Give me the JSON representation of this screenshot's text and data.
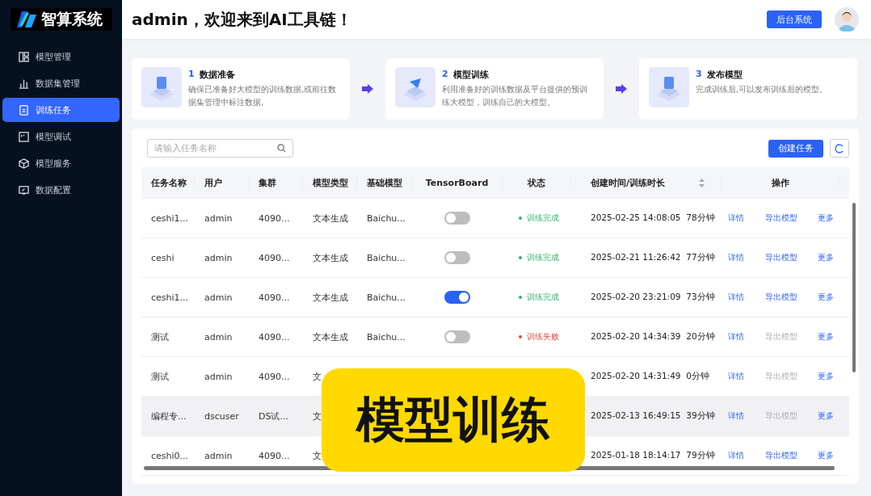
{
  "sidebar": {
    "logo": "智算系统",
    "items": [
      {
        "label": "模型管理",
        "selected": false
      },
      {
        "label": "数据集管理",
        "selected": false
      },
      {
        "label": "训练任务",
        "selected": true
      },
      {
        "label": "模型调试",
        "selected": false
      },
      {
        "label": "模型服务",
        "selected": false
      },
      {
        "label": "数据配置",
        "selected": false
      }
    ]
  },
  "header": {
    "title": "admin，欢迎来到AI工具链！",
    "button": "后台系统"
  },
  "steps": [
    {
      "number": "1",
      "title": "数据准备",
      "text": "确保已准备好大模型的训练数据,或前往数据集管理中标注数据,"
    },
    {
      "number": "2",
      "title": "模型训练",
      "text": "利用准备好的训练数据及平台提供的预训练大模型，训练自己的大模型。"
    },
    {
      "number": "3",
      "title": "发布模型",
      "text": "完成训练后,可以发布训练后的模型。"
    }
  ],
  "toolbar": {
    "search_placeholder": "请输入任务名称",
    "create_button": "创建任务"
  },
  "table": {
    "columns": [
      "任务名称",
      "用户",
      "集群",
      "模型类型",
      "基础模型",
      "TensorBoard",
      "状态",
      "创建时间/训练时长",
      "操作"
    ],
    "rows": [
      {
        "name": "ceshi1...",
        "user": "admin",
        "cluster": "4090...",
        "type": "文本生成",
        "base": "Baichu...",
        "tensorboard": false,
        "status": "训练完成",
        "color": "#2fb36b",
        "created": "2025-02-25 14:08:05",
        "duration": "78分钟",
        "detail": "详情",
        "export": "导出模型",
        "export_disabled": false,
        "more": "更多",
        "selected": false
      },
      {
        "name": "ceshi",
        "user": "admin",
        "cluster": "4090...",
        "type": "文本生成",
        "base": "Baichu...",
        "tensorboard": false,
        "status": "训练完成",
        "color": "#2fb36b",
        "created": "2025-02-21 11:26:42",
        "duration": "77分钟",
        "detail": "详情",
        "export": "导出模型",
        "export_disabled": false,
        "more": "更多",
        "selected": false
      },
      {
        "name": "ceshi1...",
        "user": "admin",
        "cluster": "4090...",
        "type": "文本生成",
        "base": "Baichu...",
        "tensorboard": true,
        "status": "训练完成",
        "color": "#2fb36b",
        "created": "2025-02-20 23:21:09",
        "duration": "73分钟",
        "detail": "详情",
        "export": "导出模型",
        "export_disabled": false,
        "more": "更多",
        "selected": false
      },
      {
        "name": "测试",
        "user": "admin",
        "cluster": "4090...",
        "type": "文本生成",
        "base": "Baichu...",
        "tensorboard": false,
        "status": "训练失败",
        "color": "#e0483e",
        "created": "2025-02-20 14:34:39",
        "duration": "20分钟",
        "detail": "详情",
        "export": "导出模型",
        "export_disabled": true,
        "more": "更多",
        "selected": false
      },
      {
        "name": "测试",
        "user": "admin",
        "cluster": "4090...",
        "type": "文",
        "created": "2025-02-20 14:31:49",
        "duration": "0分钟",
        "detail": "详情",
        "export": "导出模型",
        "export_disabled": true,
        "more": "更多",
        "selected": false
      },
      {
        "name": "编程专...",
        "user": "dscuser",
        "cluster": "DS试...",
        "type": "文",
        "created": "2025-02-13 16:49:15",
        "duration": "39分钟",
        "detail": "详情",
        "export": "导出模型",
        "export_disabled": true,
        "more": "更多",
        "selected": true
      },
      {
        "name": "ceshi0...",
        "user": "admin",
        "cluster": "4090...",
        "type": "文",
        "created": "2025-01-18 18:14:17",
        "duration": "79分钟",
        "detail": "详情",
        "export": "导出模型",
        "export_disabled": false,
        "more": "更多",
        "selected": false
      }
    ]
  },
  "caption": "模型训练"
}
